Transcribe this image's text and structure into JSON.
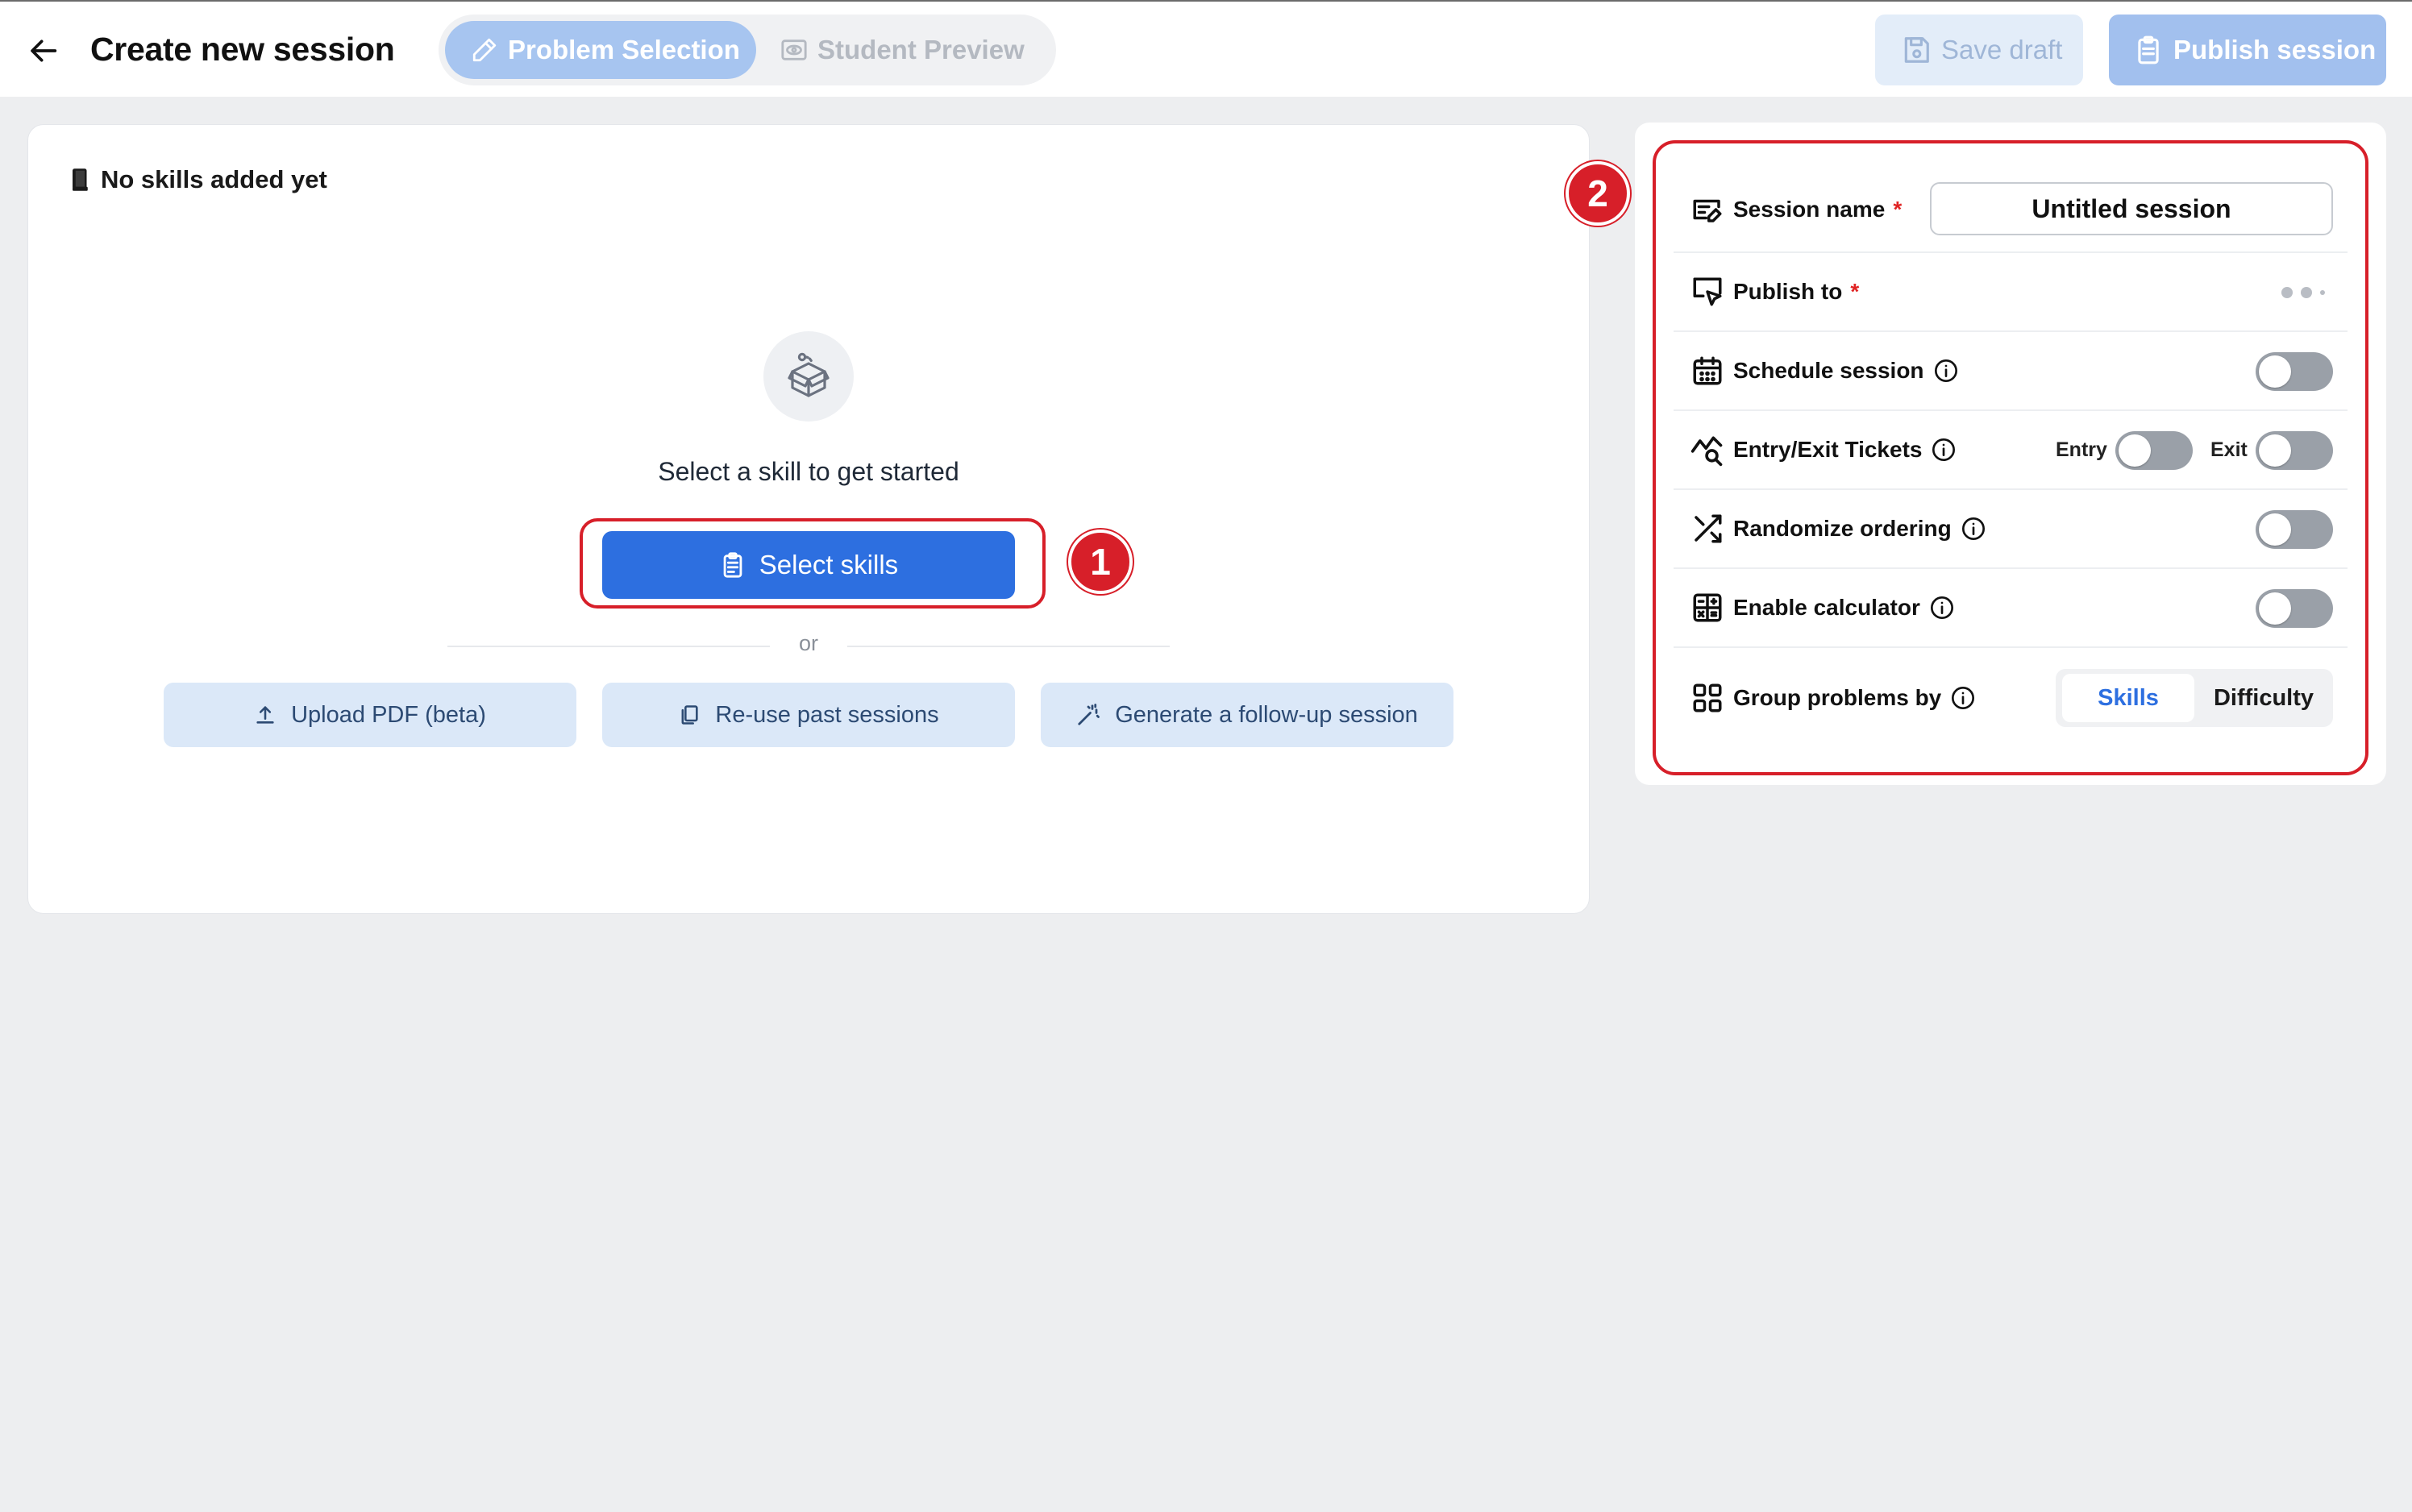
{
  "header": {
    "title": "Create new session",
    "tabs": [
      {
        "label": "Problem Selection",
        "active": true
      },
      {
        "label": "Student Preview",
        "active": false
      }
    ],
    "save_label": "Save draft",
    "publish_label": "Publish session"
  },
  "skills_panel": {
    "heading": "No skills added yet",
    "empty_text": "Select a skill to get started",
    "select_button": "Select skills",
    "or_text": "or",
    "upload_button": "Upload PDF (beta)",
    "reuse_button": "Re-use past sessions",
    "generate_button": "Generate a follow-up session"
  },
  "settings": {
    "session_name_label": "Session name",
    "session_name_value": "Untitled session",
    "publish_to_label": "Publish to",
    "schedule_label": "Schedule session",
    "schedule_on": false,
    "tickets_label": "Entry/Exit Tickets",
    "entry_label": "Entry",
    "exit_label": "Exit",
    "entry_on": false,
    "exit_on": false,
    "randomize_label": "Randomize ordering",
    "randomize_on": false,
    "calculator_label": "Enable calculator",
    "calculator_on": false,
    "group_label": "Group problems by",
    "group_options": [
      "Skills",
      "Difficulty"
    ],
    "group_selected": "Skills",
    "required_mark": "*"
  },
  "annotations": {
    "badge_1": "1",
    "badge_2": "2"
  },
  "colors": {
    "primary": "#2d6fe0",
    "highlight": "#d71f29",
    "toggle_off": "#9aa0a8"
  }
}
